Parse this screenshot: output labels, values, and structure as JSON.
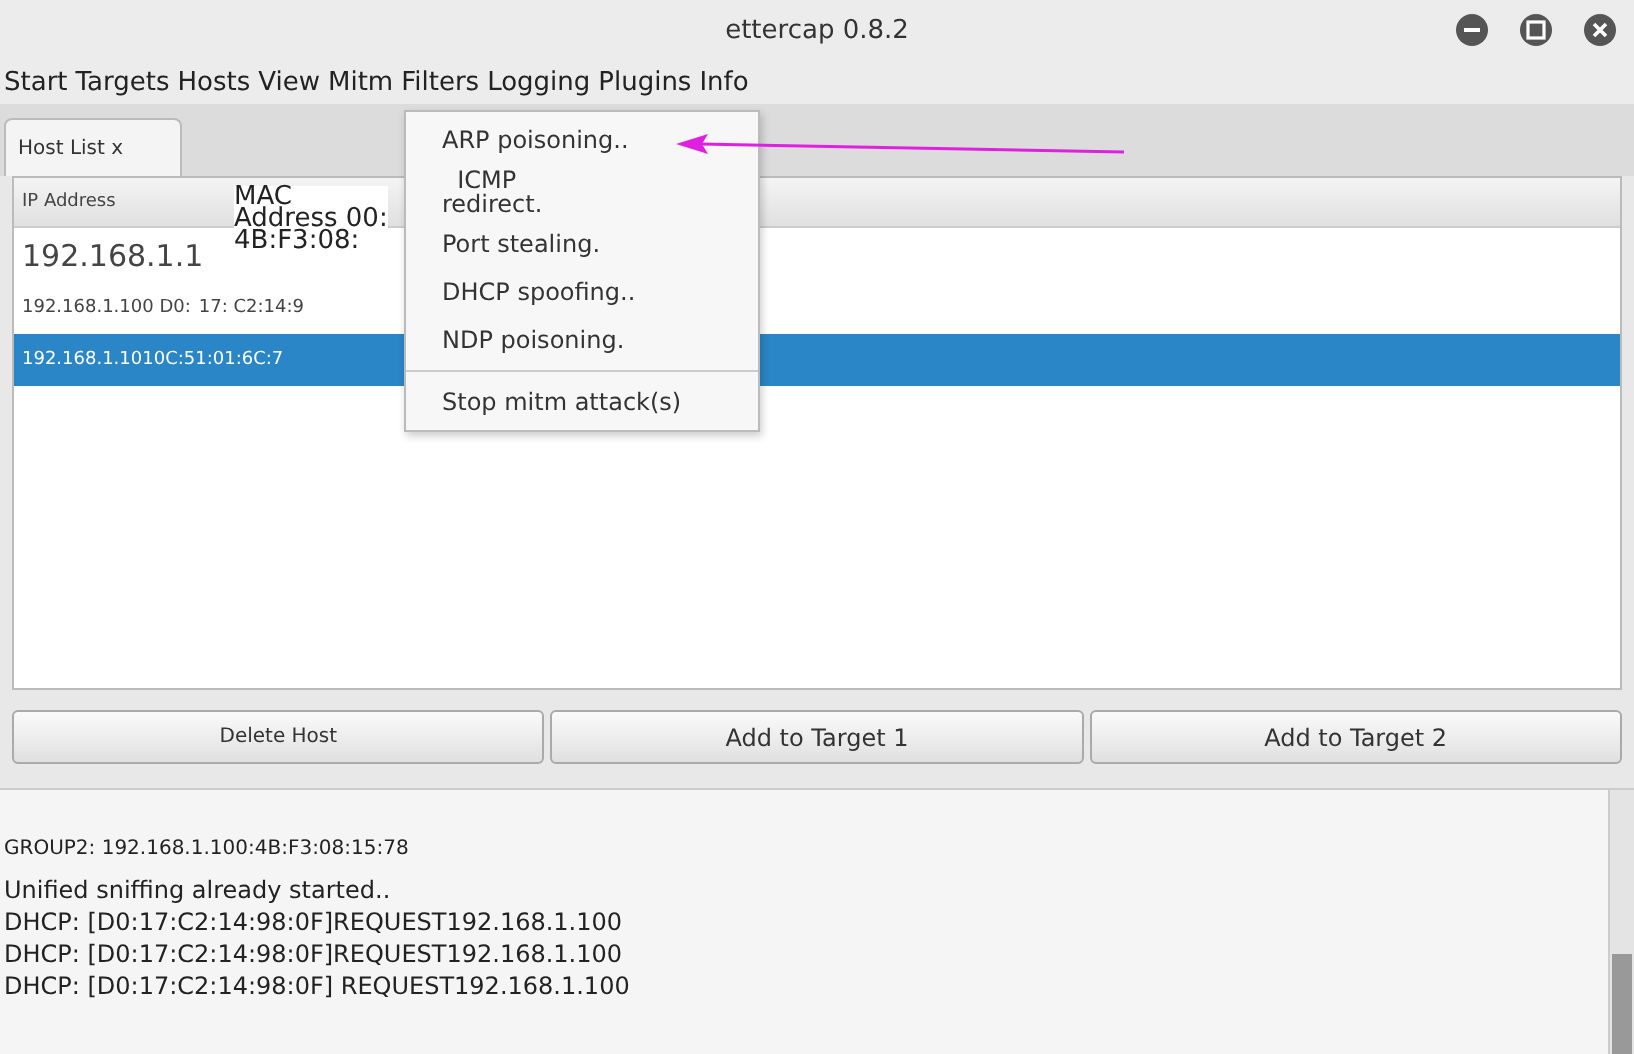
{
  "window": {
    "title": "ettercap 0.8.2"
  },
  "menu": [
    "Start",
    "Targets",
    "Hosts",
    "View",
    "Mitm",
    "Filters",
    "Logging",
    "Plugins",
    "Info"
  ],
  "tabs": [
    {
      "label": "Host List x",
      "selected": true
    }
  ],
  "table": {
    "columns": [
      "IP Address",
      "MAC\nAddress 00:\n4B:F3:08:"
    ],
    "rows": [
      {
        "ip": "192.168.1.1",
        "mac": "",
        "large": true,
        "selected": false
      },
      {
        "ip": "192.168.1.100 D0:",
        "mac": "17: C2:14:9",
        "large": false,
        "selected": false
      },
      {
        "ip": "192.168.1.1010C:51:01:6C:7",
        "mac": "",
        "large": false,
        "selected": true
      }
    ]
  },
  "buttons": [
    "Delete Host",
    "Add to Target 1",
    "Add to Target 2"
  ],
  "mitm_menu": [
    {
      "kind": "item",
      "label": "ARP poisoning.."
    },
    {
      "kind": "item",
      "label": "  ICMP\nredirect."
    },
    {
      "kind": "item",
      "label": "Port stealing."
    },
    {
      "kind": "item",
      "label": "DHCP spoofing.."
    },
    {
      "kind": "item",
      "label": "NDP poisoning."
    },
    {
      "kind": "separator"
    },
    {
      "kind": "item",
      "label": "Stop mitm attack(s)"
    }
  ],
  "log": [
    {
      "text": "GROUP2: 192.168.1.100:4B:F3:08:15:78",
      "small": true
    },
    {
      "text": "Unified sniffing already started..",
      "small": false
    },
    {
      "text": "DHCP: [D0:17:C2:14:98:0F]REQUEST192.168.1.100",
      "small": false
    },
    {
      "text": "DHCP: [D0:17:C2:14:98:0F]REQUEST192.168.1.100",
      "small": false
    },
    {
      "text": "DHCP: [D0:17:C2:14:98:0F] REQUEST192.168.1.100",
      "small": false
    }
  ]
}
